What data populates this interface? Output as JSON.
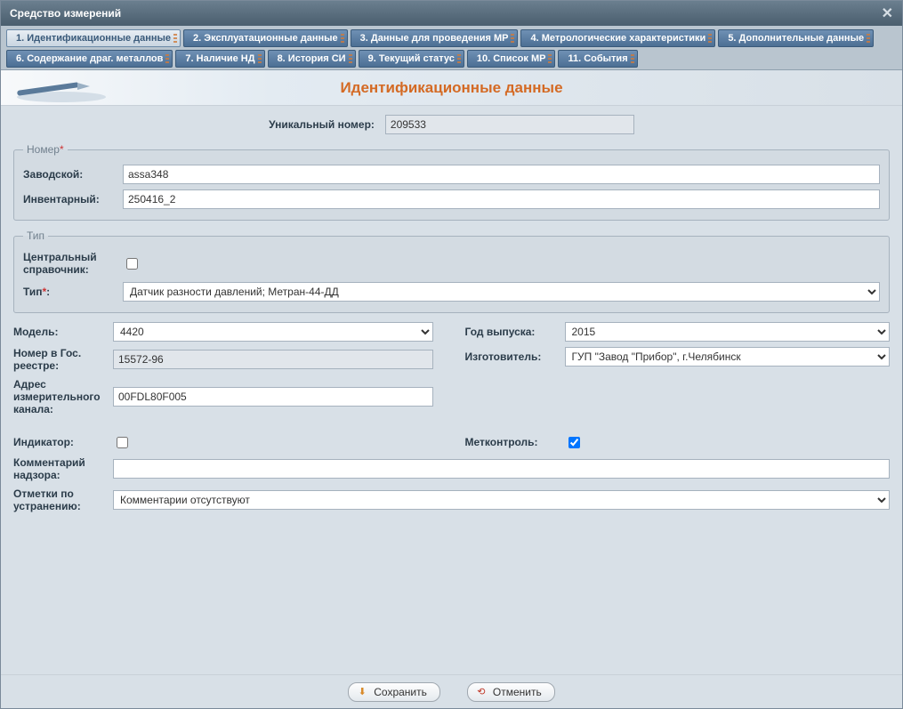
{
  "window": {
    "title": "Средство измерений"
  },
  "tabs": [
    "1. Идентификационные данные",
    "2. Эксплуатационные данные",
    "3. Данные для проведения МР",
    "4. Метрологические характеристики",
    "5. Дополнительные данные",
    "6. Содержание драг. металлов",
    "7. Наличие НД",
    "8. История СИ",
    "9. Текущий статус",
    "10. Список МР",
    "11. События"
  ],
  "section_title": "Идентификационные данные",
  "labels": {
    "unique_id": "Уникальный номер:",
    "number_group": "Номер",
    "factory": "Заводской:",
    "inventory": "Инвентарный:",
    "type_group": "Тип",
    "central_ref": "Центральный справочник:",
    "type": "Тип",
    "model": "Модель:",
    "prod_year": "Год выпуска:",
    "registry_no": "Номер в Гос. реестре:",
    "manufacturer": "Изготовитель:",
    "channel_addr": "Адрес измерительного канала:",
    "indicator": "Индикатор:",
    "metcontrol": "Метконтроль:",
    "supervision_comment": "Комментарий надзора:",
    "remarks": "Отметки по устранению:"
  },
  "values": {
    "unique_id": "209533",
    "factory": "assa348",
    "inventory": "250416_2",
    "type": "Датчик разности давлений; Метран-44-ДД",
    "model": "4420",
    "prod_year": "2015",
    "registry_no": "15572-96",
    "manufacturer": "ГУП \"Завод \"Прибор\", г.Челябинск",
    "channel_addr": "00FDL80F005",
    "supervision_comment": "",
    "remarks": "Комментарии отсутствуют",
    "central_ref_checked": false,
    "indicator_checked": false,
    "metcontrol_checked": true
  },
  "buttons": {
    "save": "Сохранить",
    "cancel": "Отменить"
  }
}
